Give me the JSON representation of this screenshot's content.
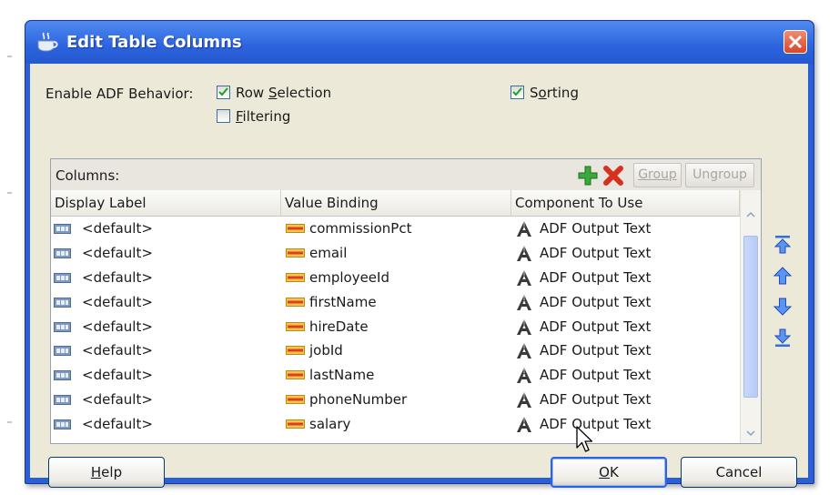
{
  "window": {
    "title": "Edit Table Columns",
    "close_label": "×"
  },
  "behavior": {
    "label": "Enable ADF Behavior:",
    "row_selection": {
      "label_pre": "Row ",
      "label_ul": "S",
      "label_post": "election",
      "checked": true
    },
    "filtering": {
      "label_pre": "",
      "label_ul": "F",
      "label_post": "iltering",
      "checked": false
    },
    "sorting": {
      "label_pre": "S",
      "label_ul": "o",
      "label_post": "rting",
      "checked": true
    }
  },
  "columns_panel": {
    "label": "Columns:",
    "group_label": "Group",
    "ungroup_label": "Ungroup",
    "headers": [
      "Display Label",
      "Value Binding",
      "Component To Use"
    ],
    "rows": [
      {
        "display": "<default>",
        "binding": "commissionPct",
        "component": "ADF Output Text"
      },
      {
        "display": "<default>",
        "binding": "email",
        "component": "ADF Output Text"
      },
      {
        "display": "<default>",
        "binding": "employeeId",
        "component": "ADF Output Text"
      },
      {
        "display": "<default>",
        "binding": "firstName",
        "component": "ADF Output Text"
      },
      {
        "display": "<default>",
        "binding": "hireDate",
        "component": "ADF Output Text"
      },
      {
        "display": "<default>",
        "binding": "jobId",
        "component": "ADF Output Text"
      },
      {
        "display": "<default>",
        "binding": "lastName",
        "component": "ADF Output Text"
      },
      {
        "display": "<default>",
        "binding": "phoneNumber",
        "component": "ADF Output Text"
      },
      {
        "display": "<default>",
        "binding": "salary",
        "component": "ADF Output Text"
      }
    ]
  },
  "buttons": {
    "help": {
      "ul": "H",
      "rest": "elp"
    },
    "ok": {
      "ul": "O",
      "rest": "K"
    },
    "cancel": "Cancel"
  },
  "colors": {
    "titlebar": "#2c63de",
    "dialog_face": "#ece9d8",
    "add_green": "#3aa83a",
    "delete_red": "#d6301f",
    "move_arrow_blue": "#2f6fe0"
  },
  "icons": {
    "title": "coffee-cup-icon",
    "add": "add-plus-icon",
    "delete": "delete-x-icon",
    "display_label": "text-field-icon",
    "value_binding": "binding-icon",
    "component": "output-text-icon",
    "move_top": "move-top-icon",
    "move_up": "move-up-icon",
    "move_down": "move-down-icon",
    "move_bottom": "move-bottom-icon"
  }
}
